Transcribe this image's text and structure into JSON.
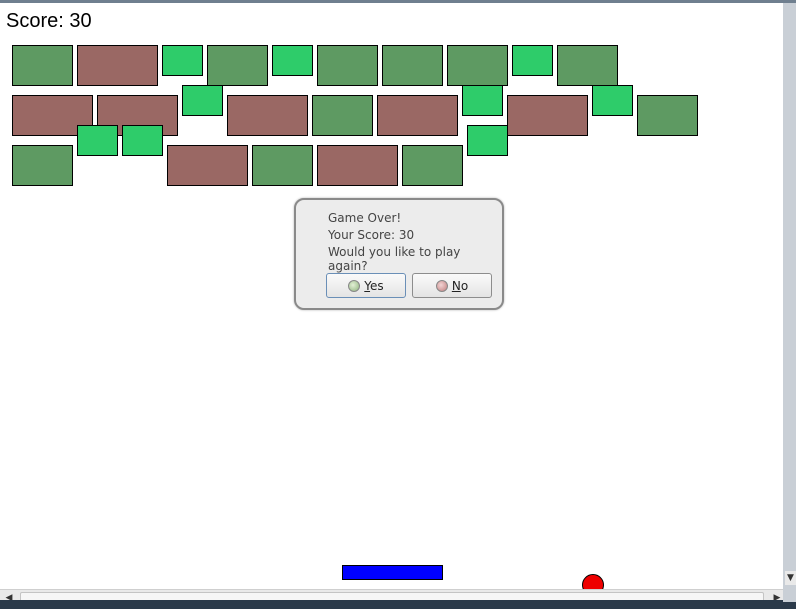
{
  "game": {
    "score_label": "Score: 30",
    "bricks_rows": {
      "row1": [
        "green",
        "brown",
        "lightgreen",
        "green",
        "lightgreen",
        "green",
        "green",
        "green",
        "lightgreen",
        "green"
      ],
      "row2": [
        "brown",
        "brown",
        "lightgreen",
        "brown",
        "green",
        "brown",
        "lightgreen",
        "brown",
        "lightgreen",
        "green"
      ],
      "row3": [
        "green",
        "lightgreen",
        "lightgreen",
        "brown",
        "green",
        "brown",
        "green",
        "lightgreen"
      ]
    },
    "colors": {
      "green": "#5e9a62",
      "brown": "#9a6864",
      "lightgreen": "#2ecc6a",
      "paddle": "#0000ff",
      "ball": "#ee0000"
    }
  },
  "dialog": {
    "line1": "Game Over!",
    "line2": "Your Score: 30",
    "line3": "Would you like to play again?",
    "yes_mnemonic": "Y",
    "yes_rest": "es",
    "no_mnemonic": "N",
    "no_rest": "o"
  }
}
